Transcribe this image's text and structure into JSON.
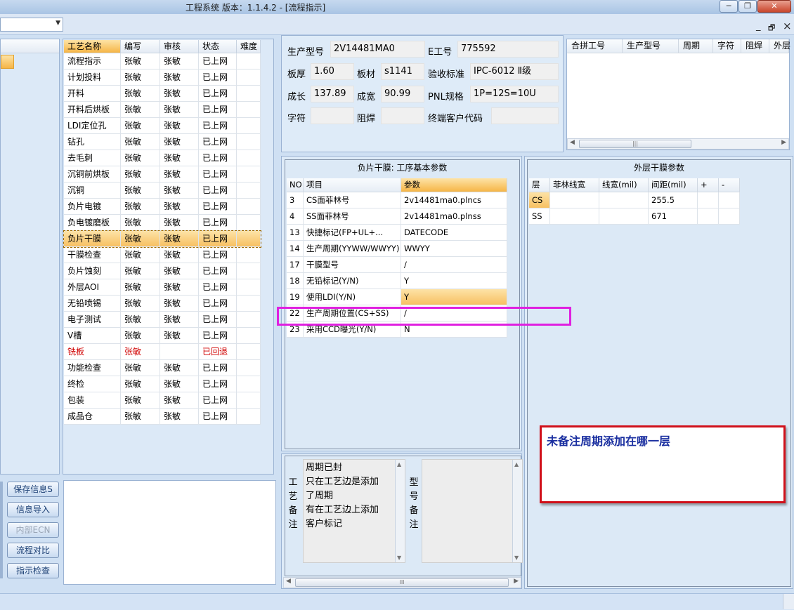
{
  "window": {
    "title": "工程系统   版本：1.1.4.2 - [流程指示]",
    "minimize": "─",
    "restore": "❐",
    "close": "✕"
  },
  "mdi_controls": {
    "minimize": "_",
    "restore": "🗗",
    "close": "×"
  },
  "process_grid": {
    "headers": [
      "工艺名称",
      "编写",
      "审核",
      "状态",
      "难度"
    ],
    "rows": [
      {
        "name": "流程指示",
        "writer": "张敏",
        "reviewer": "张敏",
        "status": "已上网",
        "difficulty": ""
      },
      {
        "name": "计划投料",
        "writer": "张敏",
        "reviewer": "张敏",
        "status": "已上网",
        "difficulty": ""
      },
      {
        "name": "开料",
        "writer": "张敏",
        "reviewer": "张敏",
        "status": "已上网",
        "difficulty": ""
      },
      {
        "name": "开料后烘板",
        "writer": "张敏",
        "reviewer": "张敏",
        "status": "已上网",
        "difficulty": ""
      },
      {
        "name": "LDI定位孔",
        "writer": "张敏",
        "reviewer": "张敏",
        "status": "已上网",
        "difficulty": ""
      },
      {
        "name": "钻孔",
        "writer": "张敏",
        "reviewer": "张敏",
        "status": "已上网",
        "difficulty": ""
      },
      {
        "name": "去毛刺",
        "writer": "张敏",
        "reviewer": "张敏",
        "status": "已上网",
        "difficulty": ""
      },
      {
        "name": "沉铜前烘板",
        "writer": "张敏",
        "reviewer": "张敏",
        "status": "已上网",
        "difficulty": ""
      },
      {
        "name": "沉铜",
        "writer": "张敏",
        "reviewer": "张敏",
        "status": "已上网",
        "difficulty": ""
      },
      {
        "name": "负片电镀",
        "writer": "张敏",
        "reviewer": "张敏",
        "status": "已上网",
        "difficulty": ""
      },
      {
        "name": "负电镀磨板",
        "writer": "张敏",
        "reviewer": "张敏",
        "status": "已上网",
        "difficulty": ""
      },
      {
        "name": "负片干膜",
        "writer": "张敏",
        "reviewer": "张敏",
        "status": "已上网",
        "difficulty": "",
        "selected": true
      },
      {
        "name": "干膜检查",
        "writer": "张敏",
        "reviewer": "张敏",
        "status": "已上网",
        "difficulty": ""
      },
      {
        "name": "负片蚀刻",
        "writer": "张敏",
        "reviewer": "张敏",
        "status": "已上网",
        "difficulty": ""
      },
      {
        "name": "外层AOI",
        "writer": "张敏",
        "reviewer": "张敏",
        "status": "已上网",
        "difficulty": ""
      },
      {
        "name": "无铅喷锡",
        "writer": "张敏",
        "reviewer": "张敏",
        "status": "已上网",
        "difficulty": ""
      },
      {
        "name": "电子测试",
        "writer": "张敏",
        "reviewer": "张敏",
        "status": "已上网",
        "difficulty": ""
      },
      {
        "name": "V槽",
        "writer": "张敏",
        "reviewer": "张敏",
        "status": "已上网",
        "difficulty": ""
      },
      {
        "name": "铣板",
        "writer": "张敏",
        "reviewer": "",
        "status": "已回退",
        "difficulty": "",
        "returned": true
      },
      {
        "name": "功能检查",
        "writer": "张敏",
        "reviewer": "张敏",
        "status": "已上网",
        "difficulty": ""
      },
      {
        "name": "终检",
        "writer": "张敏",
        "reviewer": "张敏",
        "status": "已上网",
        "difficulty": ""
      },
      {
        "name": "包装",
        "writer": "张敏",
        "reviewer": "张敏",
        "status": "已上网",
        "difficulty": ""
      },
      {
        "name": "成品仓",
        "writer": "张敏",
        "reviewer": "张敏",
        "status": "已上网",
        "difficulty": ""
      }
    ]
  },
  "buttons": {
    "save_info": "保存信息S",
    "import_info": "信息导入",
    "internal_ecn": "内部ECN",
    "flow_compare": "流程对比",
    "indication_check": "指示检查"
  },
  "product_info": {
    "model_label": "生产型号",
    "model": "2V14481MA0",
    "e_no_label": "E工号",
    "e_no": "775592",
    "thickness_label": "板厚",
    "thickness": "1.60",
    "material_label": "板材",
    "material": "s1141",
    "standard_label": "验收标准",
    "standard": "IPC-6012 Ⅱ级",
    "length_label": "成长",
    "length": "137.89",
    "width_label": "成宽",
    "width": "90.99",
    "pnl_label": "PNL规格",
    "pnl": "1P=12S=10U",
    "char_label": "字符",
    "char": "",
    "mask_label": "阻焊",
    "mask": "",
    "end_customer_label": "终端客户代码",
    "end_customer": ""
  },
  "combo_grid": {
    "headers": [
      "合拼工号",
      "生产型号",
      "周期",
      "字符",
      "阻焊",
      "外层"
    ],
    "scroll_thumb": "|||"
  },
  "params_section": {
    "title": "负片干膜: 工序基本参数",
    "headers": [
      "NO",
      "项目",
      "参数"
    ],
    "rows": [
      {
        "no": "3",
        "item": "CS面菲林号",
        "value": "2v14481ma0.plncs"
      },
      {
        "no": "4",
        "item": "SS面菲林号",
        "value": "2v14481ma0.plnss"
      },
      {
        "no": "13",
        "item": "快捷标记(FP+UL+...",
        "value": "DATECODE"
      },
      {
        "no": "14",
        "item": "生产周期(YYWW/WWYY)",
        "value": "WWYY"
      },
      {
        "no": "17",
        "item": "干膜型号",
        "value": "/"
      },
      {
        "no": "18",
        "item": "无铅标记(Y/N)",
        "value": "Y"
      },
      {
        "no": "19",
        "item": "使用LDI(Y/N)",
        "value": "Y",
        "selected": true
      },
      {
        "no": "22",
        "item": "生产周期位置(CS+SS)",
        "value": "/"
      },
      {
        "no": "23",
        "item": "采用CCD曝光(Y/N)",
        "value": "N"
      }
    ]
  },
  "outer_section": {
    "title": "外层干膜参数",
    "headers": [
      "层",
      "菲林线宽",
      "线宽(mil)",
      "间距(mil)",
      "+",
      "-"
    ],
    "rows": [
      {
        "layer": "CS",
        "film_width": "",
        "line_width": "",
        "spacing": "255.5",
        "plus": "",
        "minus": "",
        "selected": true
      },
      {
        "layer": "SS",
        "film_width": "",
        "line_width": "",
        "spacing": "671",
        "plus": "",
        "minus": ""
      }
    ]
  },
  "process_note": {
    "label_chars": [
      "工",
      "艺",
      "备",
      "注"
    ],
    "lines": [
      "周期已封",
      "只在工艺边是添加",
      "了周期",
      "有在工艺边上添加",
      "客户标记"
    ]
  },
  "model_note": {
    "label_chars": [
      "型",
      "号",
      "备",
      "注"
    ]
  },
  "annotation": {
    "text": "未备注周期添加在哪一层",
    "box_color": "#d0101a",
    "highlight_color": "#e020e0",
    "text_color": "#1a2fa0"
  },
  "scroll_arrows": {
    "left": "◀",
    "right": "▶",
    "up": "▲",
    "down": "▼",
    "thumb": "III"
  }
}
